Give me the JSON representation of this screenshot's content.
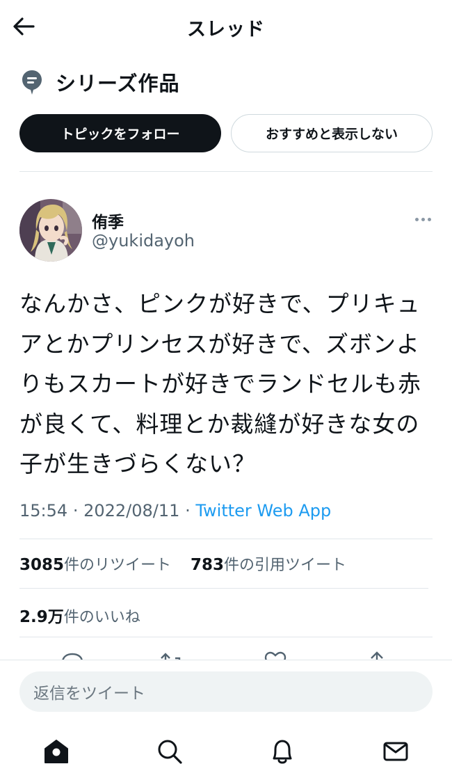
{
  "header": {
    "title": "スレッド",
    "back_icon": "arrow-left-icon"
  },
  "topic": {
    "icon": "topic-icon",
    "title": "シリーズ作品",
    "follow_label": "トピックをフォロー",
    "hide_label": "おすすめと表示しない"
  },
  "tweet": {
    "author": {
      "display_name": "侑季",
      "handle": "@yukidayoh"
    },
    "text": "なんかさ、ピンクが好きで、プリキュアとかプリンセスが好きで、ズボンよりもスカートが好きでランドセルも赤が良くて、料理とか裁縫が好きな女の子が生きづらくない？",
    "time": "15:54",
    "date": "2022/08/11",
    "separator": "·",
    "source": "Twitter Web App",
    "retweets_count": "3085",
    "retweets_label": "件のリツイート",
    "quotes_count": "783",
    "quotes_label": "件の引用ツイート",
    "likes_count": "2.9万",
    "likes_label": "件のいいね"
  },
  "reply": {
    "placeholder": "返信をツイート"
  },
  "tabs": [
    "home-icon",
    "search-icon",
    "bell-icon",
    "mail-icon"
  ],
  "colors": {
    "accent": "#1d9bf0",
    "text": "#0f1419",
    "secondary": "#536471"
  }
}
